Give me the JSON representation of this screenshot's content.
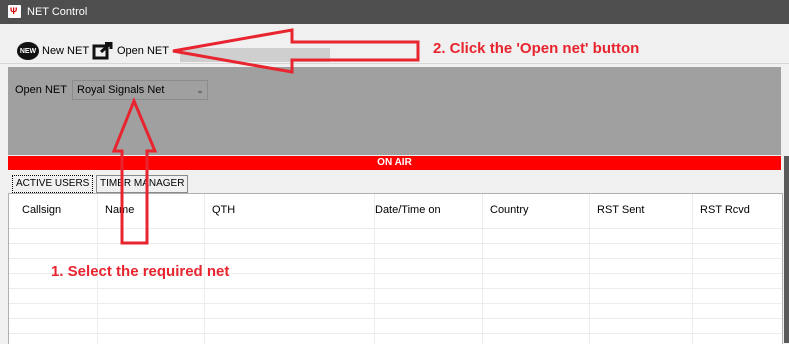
{
  "window": {
    "title": "NET Control",
    "app_icon": "radio-tower-icon"
  },
  "toolbar": {
    "new_net_icon": "new-badge-icon",
    "new_net_label": "New NET",
    "open_net_icon": "open-external-icon",
    "open_net_label": "Open NET"
  },
  "open_panel": {
    "label": "Open NET",
    "selected_net": "Royal Signals Net"
  },
  "status_bar": {
    "text": "ON AIR",
    "color": "#ff0000"
  },
  "tabs": [
    {
      "label": "ACTIVE USERS",
      "active": true
    },
    {
      "label": "TIMER MANAGER",
      "active": false
    }
  ],
  "table": {
    "columns": [
      "Callsign",
      "Name",
      "QTH",
      "Date/Time on",
      "Country",
      "RST Sent",
      "RST Rcvd"
    ]
  },
  "annotations": {
    "step1": "1. Select the required net",
    "step2": "2. Click the 'Open net' button",
    "arrow_color": "#e8242f"
  }
}
